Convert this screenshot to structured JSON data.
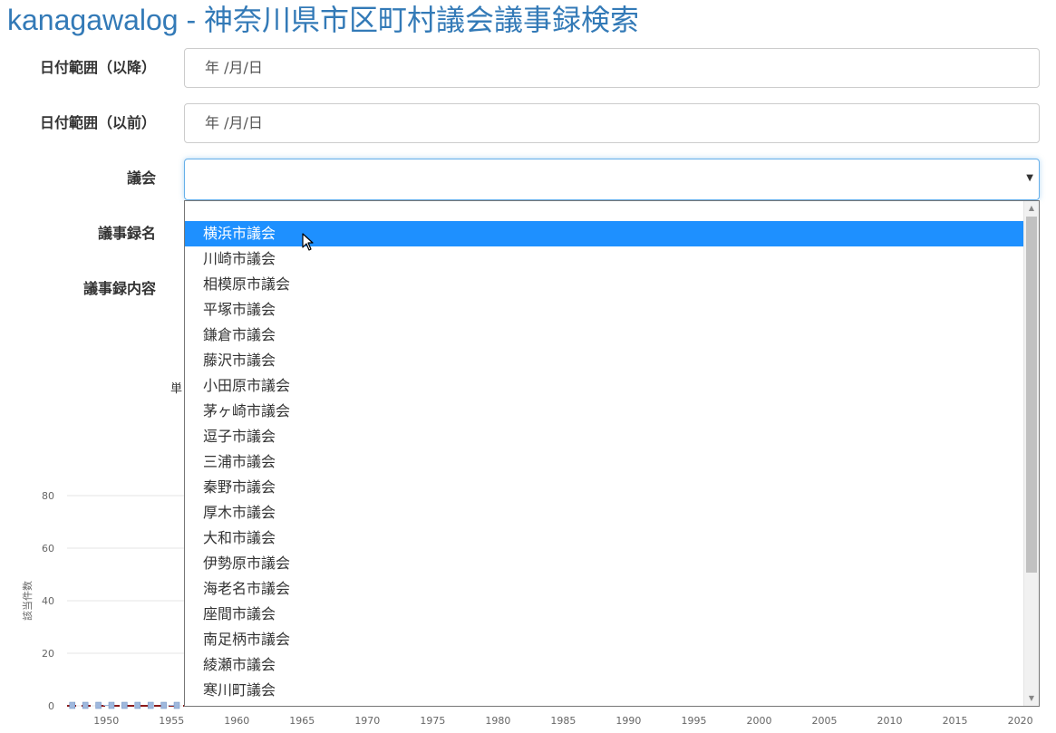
{
  "page": {
    "title": "kanagawalog - 神奈川県市区町村議会議事録検索"
  },
  "form": {
    "date_from_label": "日付範囲（以降）",
    "date_from_value": "年 /月/日",
    "date_to_label": "日付範囲（以前）",
    "date_to_value": "年 /月/日",
    "council_label": "議会",
    "council_value": "",
    "minutes_name_label": "議事録名",
    "minutes_content_label": "議事録内容",
    "partial_label": "単"
  },
  "dropdown": {
    "selected_index": 0,
    "options": [
      "横浜市議会",
      "川崎市議会",
      "相模原市議会",
      "平塚市議会",
      "鎌倉市議会",
      "藤沢市議会",
      "小田原市議会",
      "茅ヶ崎市議会",
      "逗子市議会",
      "三浦市議会",
      "秦野市議会",
      "厚木市議会",
      "大和市議会",
      "伊勢原市議会",
      "海老名市議会",
      "座間市議会",
      "南足柄市議会",
      "綾瀬市議会",
      "寒川町議会"
    ]
  },
  "chart_data": {
    "type": "bar",
    "ylabel": "該当件数",
    "ylim": [
      0,
      80
    ],
    "y_ticks": [
      "80",
      "60",
      "40",
      "20",
      "0"
    ],
    "x_ticks": [
      "1950",
      "1955",
      "1960",
      "1965",
      "1970",
      "1975",
      "1980",
      "1985",
      "1990",
      "1995",
      "2000",
      "2005",
      "2010",
      "2015",
      "2020"
    ],
    "xlim": [
      1947,
      2021
    ],
    "values_note": "",
    "series": [
      {
        "values": [
          0,
          0,
          0,
          0,
          0,
          0,
          0,
          0,
          0,
          0,
          0,
          0,
          0,
          0,
          0
        ]
      }
    ],
    "grid": true,
    "colors": {
      "bar": "#9fb8dd",
      "baseline": "#8b1a1a"
    }
  },
  "colors": {
    "title": "#337ab7",
    "selected_option_bg": "#1e90ff",
    "focus_border": "#66afe9"
  }
}
